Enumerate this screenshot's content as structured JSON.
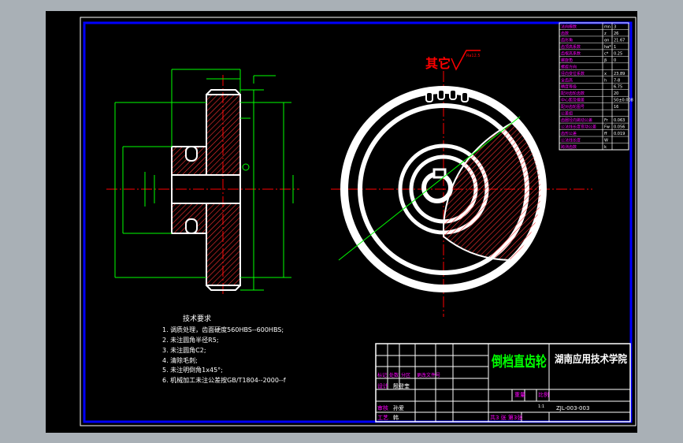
{
  "drawing": {
    "title_mark": "其它",
    "title_roughness": "Ra12.5",
    "tech_requirements": {
      "heading": "技术要求",
      "items": [
        "1. 调质处理，齿面硬度560HBS--600HBS;",
        "2. 未注圆角半径R5;",
        "3. 未注圆角C2;",
        "4. 清除毛刺;",
        "5. 未注明倒角1x45°;",
        "6. 机械加工未注公差按GB/T1804--2000--f"
      ]
    },
    "title_block": {
      "part_name": "倒档直齿轮",
      "school": "湖南应用技术学院",
      "drawing_no": "ZJL-003-003",
      "designer_label": "设计",
      "designer_name": "殷登奎",
      "checker_label": "审核",
      "checker_name": "孙爱",
      "process_label": "工艺",
      "process_name": "韩",
      "weight_label": "重量",
      "scale_label": "比例",
      "scale_value": "1:1",
      "sheet_info": "共3 张 第3张",
      "rev_cols": [
        "标记",
        "处数",
        "分区",
        "更改文件号"
      ]
    },
    "param_table": {
      "rows": [
        {
          "label": "法向模数",
          "sym": "mn",
          "val": "3"
        },
        {
          "label": "齿数",
          "sym": "z",
          "val": "26"
        },
        {
          "label": "齿形角",
          "sym": "αn",
          "val": "21.67"
        },
        {
          "label": "齿顶高系数",
          "sym": "ha*",
          "val": "1"
        },
        {
          "label": "齿根高系数",
          "sym": "c*",
          "val": "0.25"
        },
        {
          "label": "螺旋角",
          "sym": "β",
          "val": "0"
        },
        {
          "label": "螺旋方向",
          "sym": "",
          "val": ""
        },
        {
          "label": "径向变位系数",
          "sym": "x",
          "val": "23.89"
        },
        {
          "label": "全齿高",
          "sym": "h",
          "val": "7-8"
        },
        {
          "label": "精度等级",
          "sym": "",
          "val": "6.75"
        },
        {
          "label": "配对齿轮齿数",
          "sym": "",
          "val": "20"
        },
        {
          "label": "中心距及偏差",
          "sym": "",
          "val": "50±0.008"
        },
        {
          "label": "配对齿轮图号",
          "sym": "",
          "val": "16"
        },
        {
          "label": "公差组",
          "sym": "",
          "val": ""
        },
        {
          "label": "齿圈径向跳动公差",
          "sym": "Fr",
          "val": "0.063"
        },
        {
          "label": "公法线长度变动公差",
          "sym": "Fw",
          "val": "0.056"
        },
        {
          "label": "齿形公差",
          "sym": "ff",
          "val": "0.019"
        },
        {
          "label": "公法线长度",
          "sym": "W",
          "val": ""
        },
        {
          "label": "跨测齿数",
          "sym": "k",
          "val": ""
        }
      ]
    },
    "colors": {
      "background": "#000000",
      "frame": "#0000ff",
      "outline": "#ffffff",
      "dimension": "#00ff00",
      "centerline": "#ff0000",
      "hatch": "#ff3030",
      "text": "#ffffff",
      "magenta": "#ff00ff",
      "tb_title": "#00ff00"
    }
  }
}
